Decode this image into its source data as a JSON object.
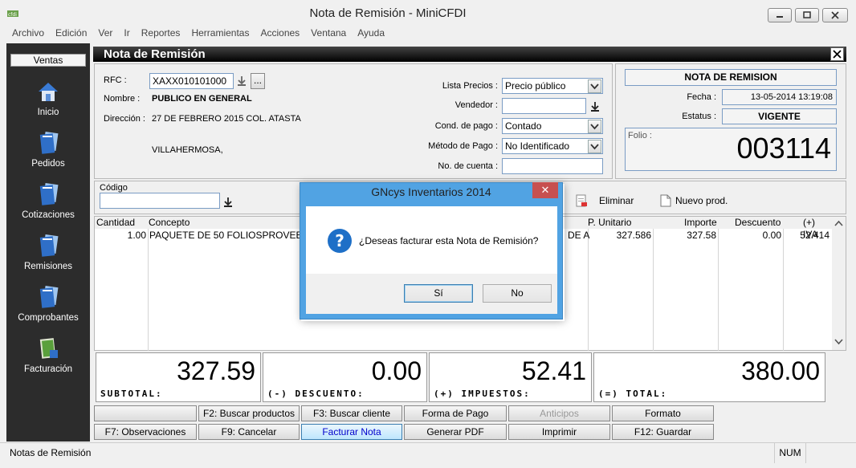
{
  "window": {
    "title": "Nota de Remisión - MiniCFDI"
  },
  "menu": [
    "Archivo",
    "Edición",
    "Ver",
    "Ir",
    "Reportes",
    "Herramientas",
    "Acciones",
    "Ventana",
    "Ayuda"
  ],
  "sidebar": {
    "header": "Ventas",
    "items": [
      {
        "label": "Inicio",
        "icon": "house-icon"
      },
      {
        "label": "Pedidos",
        "icon": "document-stack-icon"
      },
      {
        "label": "Cotizaciones",
        "icon": "document-stack-icon"
      },
      {
        "label": "Remisiones",
        "icon": "document-stack-icon"
      },
      {
        "label": "Comprobantes",
        "icon": "document-stack-icon"
      },
      {
        "label": "Facturación",
        "icon": "document-export-icon"
      }
    ]
  },
  "form": {
    "title": "Nota de Remisión"
  },
  "client": {
    "rfc_label": "RFC :",
    "rfc": "XAXX010101000",
    "ellipsis": "...",
    "nombre_label": "Nombre :",
    "nombre": "PUBLICO EN GENERAL",
    "direccion_label": "Dirección :",
    "direccion1": "27 DE FEBRERO 2015 COL. ATASTA",
    "direccion2": "VILLAHERMOSA,",
    "lista_label": "Lista Precios :",
    "lista": "Precio público",
    "vendedor_label": "Vendedor :",
    "vendedor": "",
    "cond_label": "Cond. de pago :",
    "cond": "Contado",
    "metodo_label": "Método de Pago :",
    "metodo": "No Identificado",
    "cuenta_label": "No. de cuenta :",
    "cuenta": ""
  },
  "doc": {
    "heading": "NOTA DE REMISION",
    "fecha_label": "Fecha :",
    "fecha": "13-05-2014 13:19:08",
    "estatus_label": "Estatus :",
    "estatus": "VIGENTE",
    "folio_label": "Folio :",
    "folio": "003114"
  },
  "codigo": {
    "label": "Código",
    "value": "",
    "eliminar": "Eliminar",
    "nuevo": "Nuevo prod."
  },
  "grid": {
    "headers": [
      "Cantidad",
      "Concepto",
      "P. Unitario",
      "Importe",
      "Descuento",
      "(+) IVA"
    ],
    "rows": [
      {
        "cantidad": "1.00",
        "concepto": "PAQUETE DE 50 FOLIOSPROVEE",
        "concepto_tail": "DE A",
        "unitario": "327.586",
        "importe": "327.58",
        "descuento": "0.00",
        "iva": "52.414"
      }
    ]
  },
  "totals": [
    {
      "value": "327.59",
      "label": "SUBTOTAL:"
    },
    {
      "value": "0.00",
      "label": "(-) DESCUENTO:"
    },
    {
      "value": "52.41",
      "label": "(+) IMPUESTOS:"
    },
    {
      "value": "380.00",
      "label": "(=) TOTAL:"
    }
  ],
  "buttons_row1": [
    "",
    "F2: Buscar productos",
    "F3: Buscar cliente",
    "Forma de Pago",
    "Anticipos",
    "Formato"
  ],
  "buttons_row2": [
    "F7: Observaciones",
    "F9: Cancelar",
    "Facturar Nota",
    "Generar PDF",
    "Imprimir",
    "F12:  Guardar"
  ],
  "status": {
    "text": "Notas de Remisión",
    "num": "NUM"
  },
  "dialog": {
    "title": "GNcys Inventarios 2014",
    "close": "✕",
    "message": "¿Deseas facturar esta Nota de Remisión?",
    "yes": "Sí",
    "no": "No"
  }
}
